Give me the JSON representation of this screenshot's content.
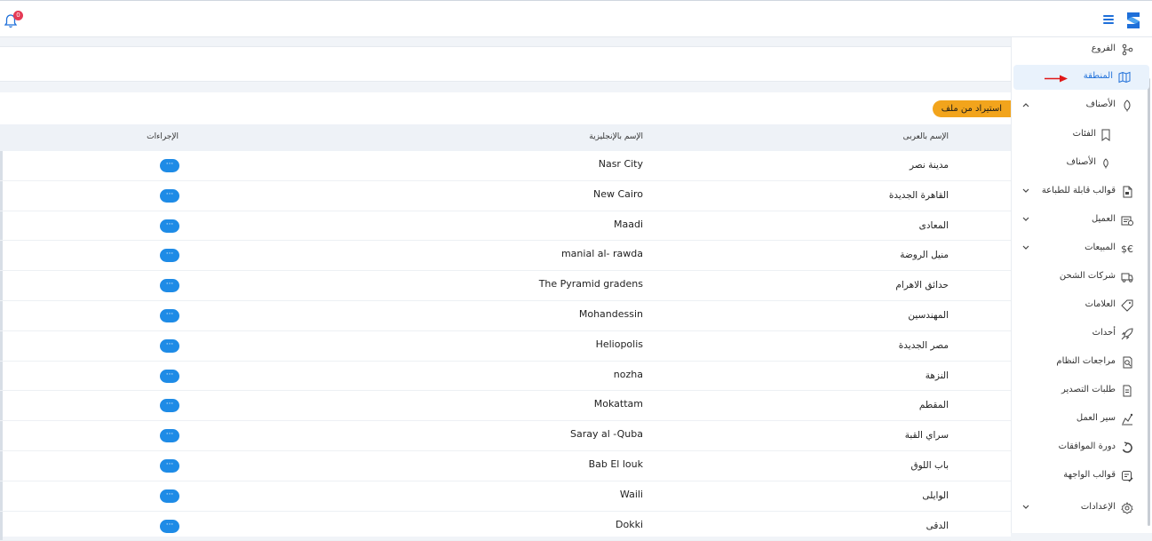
{
  "topbar": {
    "notifications_count": "0",
    "logo_icon": "brand-logo-icon",
    "menu_icon": "hamburger-icon",
    "bell_icon": "bell-icon"
  },
  "sidebar": {
    "items": [
      {
        "label": "الفروع",
        "icon": "branch-icon"
      },
      {
        "label": "المنطقة",
        "icon": "map-icon",
        "active": true
      },
      {
        "label": "الأصناف",
        "icon": "leaf-icon",
        "expanded": true
      },
      {
        "label": "الفئات",
        "icon": "bookmark-icon"
      },
      {
        "label": "الأصناف",
        "icon": "leaf-icon"
      },
      {
        "label": "قوالب قابلة للطباعة",
        "icon": "printable-doc-icon"
      },
      {
        "label": "العميل",
        "icon": "customer-icon"
      },
      {
        "label": "المبيعات",
        "icon": "currency-icon"
      },
      {
        "label": "شركات الشحن",
        "icon": "truck-icon"
      },
      {
        "label": "العلامات",
        "icon": "tag-icon"
      },
      {
        "label": "أحداث",
        "icon": "rocket-icon"
      },
      {
        "label": "مراجعات النظام",
        "icon": "audit-icon"
      },
      {
        "label": "طلبات التصدير",
        "icon": "export-icon"
      },
      {
        "label": "سير العمل",
        "icon": "workflow-icon"
      },
      {
        "label": "دورة الموافقات",
        "icon": "cycle-icon"
      },
      {
        "label": "قوالب الواجهة",
        "icon": "template-icon"
      },
      {
        "label": "الإعدادات",
        "icon": "gear-icon"
      }
    ]
  },
  "toolbar": {
    "import_label": "استيراد من ملف"
  },
  "table": {
    "headers": {
      "arabic_name": "الإسم بالعربى",
      "english_name": "الإسم بالإنجليزية",
      "actions": "الإجراءات"
    },
    "action_label": "···",
    "rows": [
      {
        "ar": "مدينة نصر",
        "en": "Nasr City"
      },
      {
        "ar": "القاهرة الجديدة",
        "en": "New Cairo"
      },
      {
        "ar": "المعادى",
        "en": "Maadi"
      },
      {
        "ar": "منيل الروضة",
        "en": "manial al- rawda"
      },
      {
        "ar": "حدائق الاهرام",
        "en": "The Pyramid gradens"
      },
      {
        "ar": "المهندسين",
        "en": "Mohandessin"
      },
      {
        "ar": "مصر الجديدة",
        "en": "Heliopolis"
      },
      {
        "ar": "النزهة",
        "en": "nozha"
      },
      {
        "ar": "المقطم",
        "en": "Mokattam"
      },
      {
        "ar": "سراي القبة",
        "en": "Saray al -Quba"
      },
      {
        "ar": "باب اللوق",
        "en": "Bab El louk"
      },
      {
        "ar": "الوايلى",
        "en": "Waili"
      },
      {
        "ar": "الدقى",
        "en": "Dokki"
      }
    ]
  },
  "colors": {
    "primary": "#1e6fd9",
    "accent": "#f2a41c",
    "action": "#1e8be6",
    "badge": "#e53a55",
    "arrow": "#e01818"
  }
}
